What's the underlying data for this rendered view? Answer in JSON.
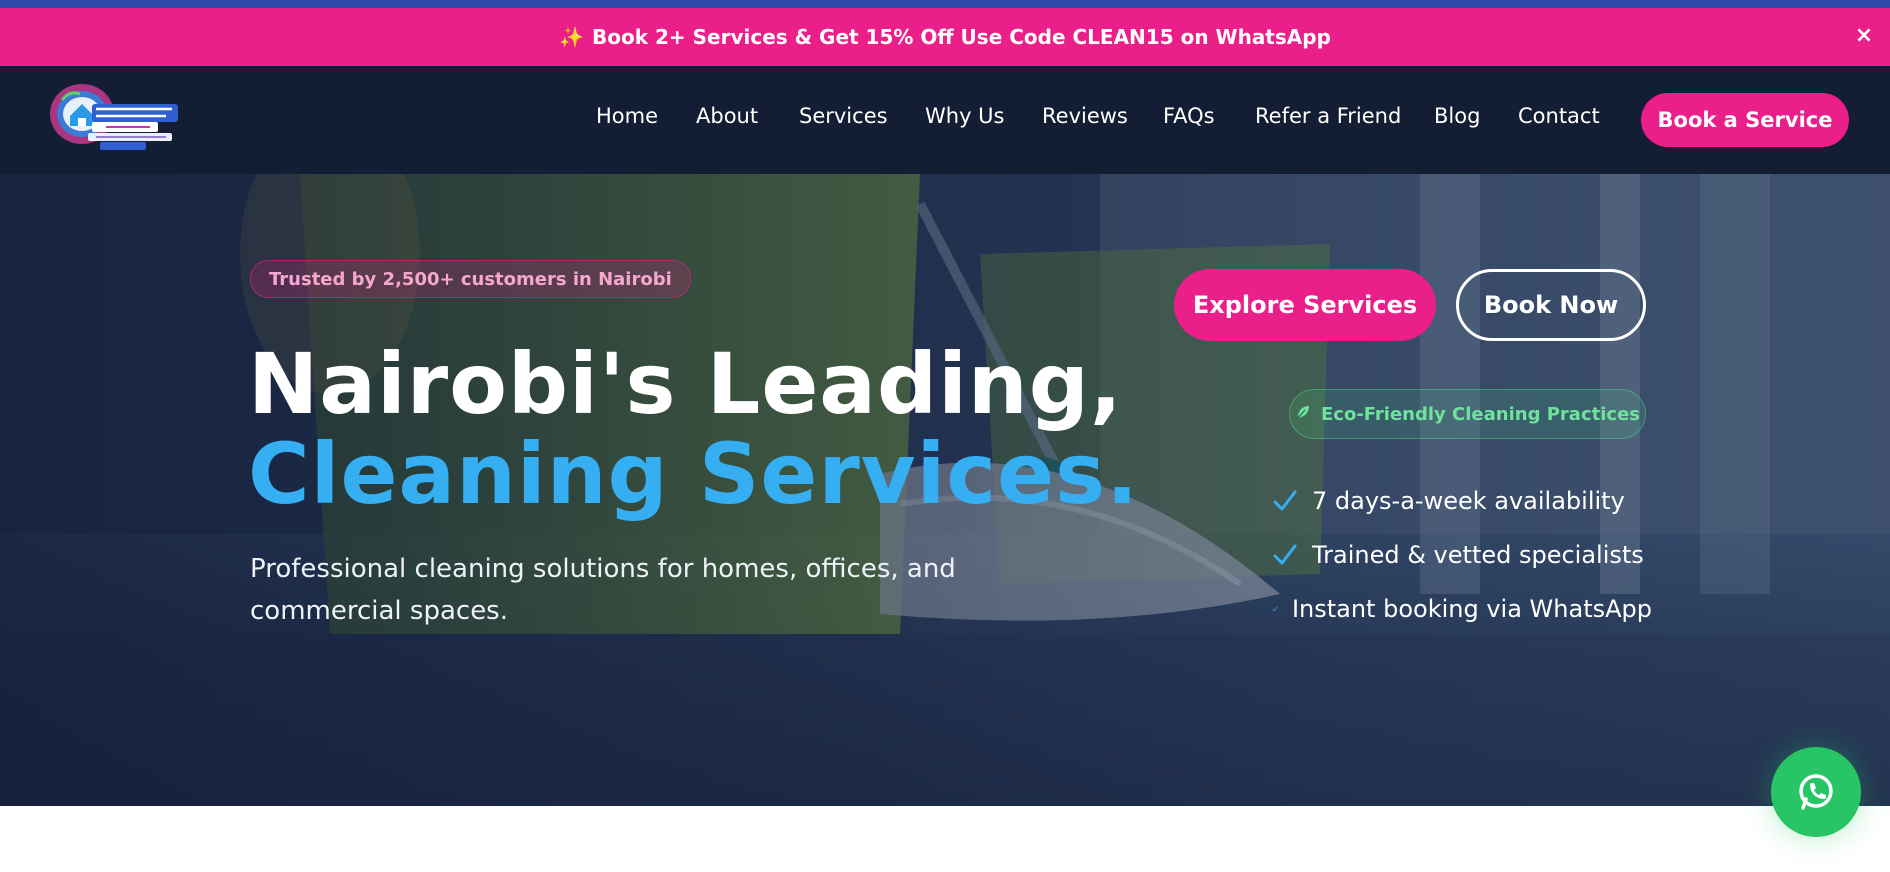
{
  "promo": {
    "icon": "sparkles-icon",
    "text": "Book 2+ Services & Get 15% Off Use Code CLEAN15 on WhatsApp",
    "close": "×"
  },
  "logo": {
    "alt": "CleanOza Services Ltd logo"
  },
  "nav": {
    "items": [
      "Home",
      "About",
      "Services",
      "Why Us",
      "Reviews",
      "FAQs",
      "Refer a Friend",
      "Blog",
      "Contact"
    ],
    "cta": "Book a Service"
  },
  "hero": {
    "badge": "Trusted by 2,500+ customers in Nairobi",
    "title_line1": "Nairobi's Leading,",
    "title_line2": "Cleaning Services.",
    "subtitle": "Professional cleaning solutions for homes, offices, and commercial spaces.",
    "explore_button": "Explore Services",
    "book_button": "Book Now",
    "eco_badge": "Eco-Friendly Cleaning Practices",
    "features": [
      "7 days-a-week availability",
      "Trained & vetted specialists",
      "Instant booking via WhatsApp"
    ]
  },
  "colors": {
    "accent": "#ea1f89",
    "nav_bg": "#131d33",
    "title_highlight": "#35aef2",
    "eco_green": "#6fe39d",
    "whatsapp": "#28c567"
  },
  "whatsapp": {
    "icon": "whatsapp-icon"
  }
}
